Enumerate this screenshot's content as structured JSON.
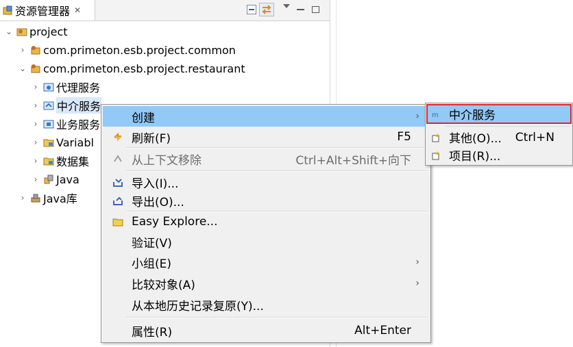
{
  "explorer": {
    "tab_title": "资源管理器",
    "tree": [
      {
        "label": "project",
        "level": 0,
        "expanded": true,
        "icon": "project-icon"
      },
      {
        "label": "com.primeton.esb.project.common",
        "level": 1,
        "expanded": false,
        "icon": "package-icon"
      },
      {
        "label": "com.primeton.esb.project.restaurant",
        "level": 1,
        "expanded": true,
        "icon": "package-icon"
      },
      {
        "label": "代理服务",
        "level": 2,
        "expanded": false,
        "icon": "proxy-service-icon"
      },
      {
        "label": "中介服务",
        "level": 2,
        "expanded": false,
        "icon": "mediation-service-icon",
        "selected": true
      },
      {
        "label": "业务服务",
        "level": 2,
        "expanded": false,
        "icon": "business-service-icon"
      },
      {
        "label": "Variabl",
        "level": 2,
        "expanded": false,
        "icon": "variable-folder-icon"
      },
      {
        "label": "数据集",
        "level": 2,
        "expanded": false,
        "icon": "dataset-folder-icon"
      },
      {
        "label": "Java",
        "level": 2,
        "expanded": false,
        "icon": "java-icon"
      },
      {
        "label": "Java库",
        "level": 1,
        "expanded": false,
        "icon": "library-icon"
      }
    ]
  },
  "context_menu": {
    "create": "创建",
    "refresh": "刷新(F)",
    "refresh_key": "F5",
    "remove_context": "从上下文移除",
    "remove_context_key": "Ctrl+Alt+Shift+向下",
    "import": "导入(I)...",
    "export": "导出(O)...",
    "easy_explore": "Easy Explore...",
    "validate": "验证(V)",
    "group": "小组(E)",
    "compare": "比较对象(A)",
    "restore": "从本地历史记录复原(Y)...",
    "properties": "属性(R)",
    "properties_key": "Alt+Enter"
  },
  "submenu": {
    "mediation": "中介服务",
    "other": "其他(O)...",
    "other_key": "Ctrl+N",
    "item": "项目(R)..."
  },
  "colors": {
    "highlight": "#91c9f7",
    "outline": "#e0262a",
    "selected_row": "#d9e8fb"
  }
}
